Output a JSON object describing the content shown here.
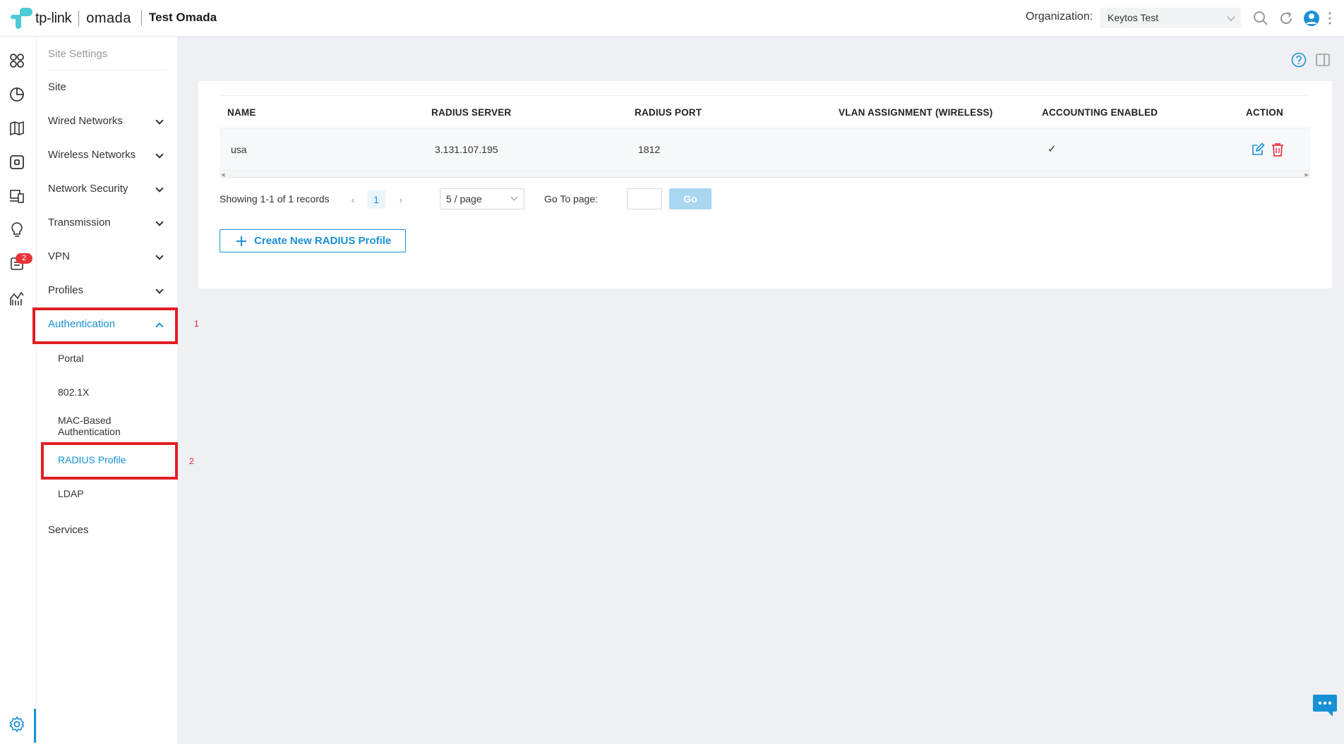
{
  "header": {
    "brand_tp": "tp-link",
    "brand_omada": "omada",
    "site_name": "Test Omada",
    "org_label": "Organization:",
    "org_value": "Keytos Test"
  },
  "rail": {
    "badge": "2"
  },
  "menu": {
    "title": "Site Settings",
    "items": [
      {
        "label": "Site"
      },
      {
        "label": "Wired Networks"
      },
      {
        "label": "Wireless Networks"
      },
      {
        "label": "Network Security"
      },
      {
        "label": "Transmission"
      },
      {
        "label": "VPN"
      },
      {
        "label": "Profiles"
      },
      {
        "label": "Authentication"
      },
      {
        "label": "Services"
      }
    ],
    "sub": [
      {
        "label": "Portal"
      },
      {
        "label": "802.1X"
      },
      {
        "label": "MAC-Based Authentication"
      },
      {
        "label": "RADIUS Profile"
      },
      {
        "label": "LDAP"
      }
    ],
    "step1": "1",
    "step2": "2"
  },
  "table": {
    "headers": [
      "NAME",
      "RADIUS SERVER",
      "RADIUS PORT",
      "VLAN ASSIGNMENT (WIRELESS)",
      "ACCOUNTING ENABLED",
      "ACTION"
    ],
    "rows": [
      {
        "name": "usa",
        "server": "3.131.107.195",
        "port": "1812",
        "vlan": "",
        "accounting": "✓"
      }
    ]
  },
  "pager": {
    "summary": "Showing 1-1 of 1 records",
    "current_page": "1",
    "page_size": "5 / page",
    "goto_label": "Go To page:",
    "go": "Go"
  },
  "create_button": "Create New RADIUS Profile",
  "colors": {
    "accent": "#1890d5",
    "danger": "#e01f26"
  }
}
